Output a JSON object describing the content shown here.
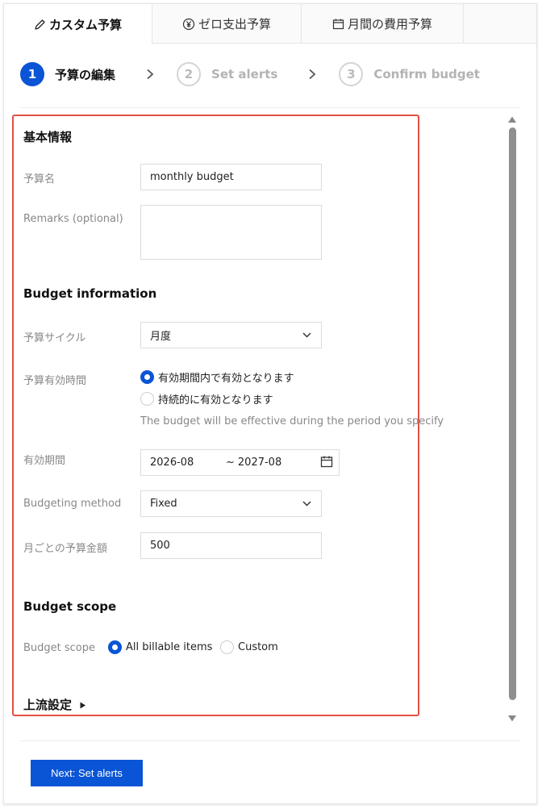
{
  "tabs": [
    {
      "label": "カスタム予算",
      "icon": "pencil-icon",
      "active": true
    },
    {
      "label": "ゼロ支出予算",
      "icon": "yen-circle-icon",
      "active": false
    },
    {
      "label": "月間の費用予算",
      "icon": "calendar-icon",
      "active": false
    }
  ],
  "steps": [
    {
      "number": "1",
      "label": "予算の編集",
      "active": true
    },
    {
      "number": "2",
      "label": "Set alerts",
      "active": false
    },
    {
      "number": "3",
      "label": "Confirm budget",
      "active": false
    }
  ],
  "basic": {
    "title": "基本情報",
    "name_label": "予算名",
    "name_value": "monthly budget",
    "remarks_label": "Remarks (optional)",
    "remarks_value": ""
  },
  "budget_info": {
    "title": "Budget information",
    "cycle_label": "予算サイクル",
    "cycle_value": "月度",
    "effective_label": "予算有効時間",
    "effective_options": [
      "有効期間内で有効となります",
      "持続的に有効となります"
    ],
    "effective_selected": 0,
    "effective_hint": "The budget will be effective during the period you specify",
    "period_label": "有効期間",
    "period_start": "2026-08",
    "period_separator": "~",
    "period_end": "2027-08",
    "method_label": "Budgeting method",
    "method_value": "Fixed",
    "amount_label": "月ごとの予算金額",
    "amount_value": "500"
  },
  "scope": {
    "title": "Budget scope",
    "label": "Budget scope",
    "options": [
      "All billable items",
      "Custom"
    ],
    "selected": 0
  },
  "advanced": {
    "label": "上流設定"
  },
  "footer": {
    "next_label": "Next: Set alerts"
  },
  "colors": {
    "accent": "#0a54d6",
    "highlight_border": "#e05145"
  }
}
